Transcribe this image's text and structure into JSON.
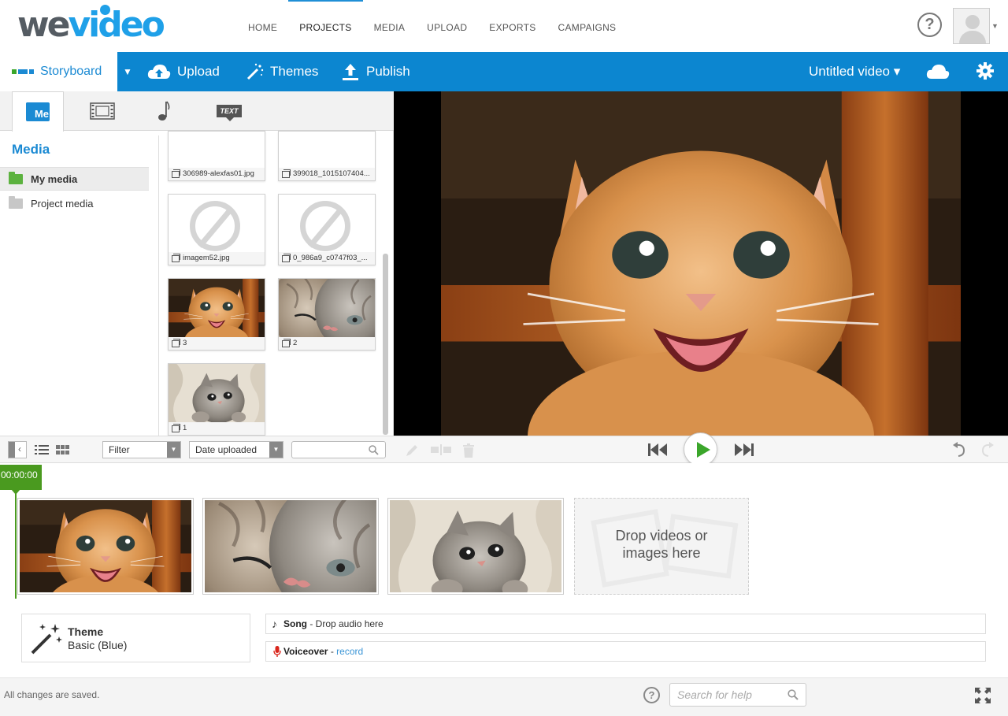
{
  "app": {
    "logo_we": "we",
    "logo_video": "video",
    "nav": [
      "HOME",
      "PROJECTS",
      "MEDIA",
      "UPLOAD",
      "EXPORTS",
      "CAMPAIGNS"
    ],
    "active_nav": "PROJECTS"
  },
  "toolbar": {
    "storyboard_label": "Storyboard",
    "upload_label": "Upload",
    "themes_label": "Themes",
    "publish_label": "Publish",
    "video_title": "Untitled video ▾"
  },
  "media": {
    "tab_me_label": "Me",
    "tab_text_label": "TEXT",
    "heading": "Media",
    "folders": [
      {
        "label": "My media",
        "selected": true
      },
      {
        "label": "Project media",
        "selected": false
      }
    ],
    "items": [
      {
        "name": "306989-alexfas01.jpg",
        "kind": "partial"
      },
      {
        "name": "399018_1015107404...",
        "kind": "partial"
      },
      {
        "name": "imagem52.jpg",
        "kind": "missing"
      },
      {
        "name": "0_986a9_c0747f03_...",
        "kind": "missing"
      },
      {
        "name": "3",
        "kind": "kitten-orange"
      },
      {
        "name": "2",
        "kind": "kittens-cuddle"
      },
      {
        "name": "1",
        "kind": "kitten-grey"
      }
    ]
  },
  "controls": {
    "filter_label": "Filter",
    "sort_label": "Date uploaded",
    "search_value": ""
  },
  "timeline": {
    "timecode": "00:00:00",
    "dropzone_text_line1": "Drop videos or",
    "dropzone_text_line2": "images here"
  },
  "theme": {
    "title": "Theme",
    "value": "Basic (Blue)"
  },
  "tracks": {
    "song_name": "Song",
    "song_text": " - Drop audio here",
    "voiceover_name": "Voiceover",
    "voiceover_sep": " - ",
    "voiceover_link": "record"
  },
  "status": {
    "text": "All changes are saved.",
    "help_search_placeholder": "Search for help"
  },
  "colors": {
    "brand_blue": "#0c86d0",
    "accent_green": "#4a9a1f",
    "link_blue": "#3a95d6"
  }
}
